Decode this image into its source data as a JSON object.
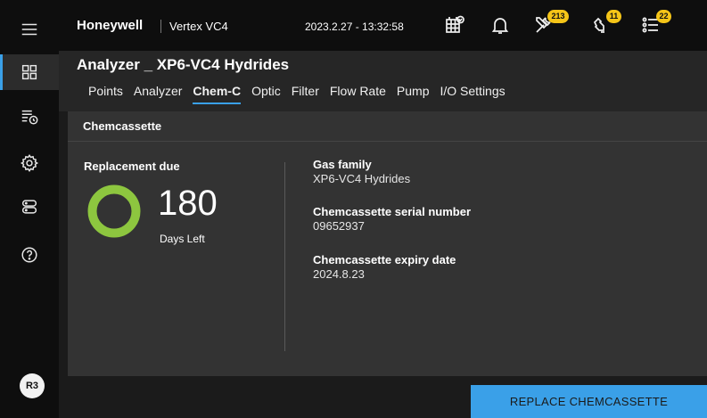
{
  "topbar": {
    "brand": "Honeywell",
    "product": "Vertex VC4",
    "datetime": "2023.2.27 - 13:32:58",
    "badges": {
      "maintenance": "213",
      "faults": "11",
      "events": "22"
    }
  },
  "sidebar": {
    "user_initials": "R3"
  },
  "page": {
    "title": "Analyzer _ XP6-VC4 Hydrides",
    "tabs": [
      {
        "label": "Points"
      },
      {
        "label": "Analyzer"
      },
      {
        "label": "Chem-C",
        "active": true
      },
      {
        "label": "Optic"
      },
      {
        "label": "Filter"
      },
      {
        "label": "Flow Rate"
      },
      {
        "label": "Pump"
      },
      {
        "label": "I/O Settings"
      }
    ]
  },
  "panel": {
    "title": "Chemcassette",
    "replacement_label": "Replacement due",
    "days_left_value": "180",
    "days_left_label": "Days Left",
    "gas_family_label": "Gas family",
    "gas_family_value": "XP6-VC4 Hydrides",
    "serial_label": "Chemcassette serial number",
    "serial_value": "09652937",
    "expiry_label": "Chemcassette expiry date",
    "expiry_value": "2024.8.23"
  },
  "footer": {
    "replace_button": "REPLACE CHEMCASSETTE"
  },
  "colors": {
    "accent": "#3aa0e8",
    "donut": "#8dc63f",
    "badge": "#f5c518"
  }
}
